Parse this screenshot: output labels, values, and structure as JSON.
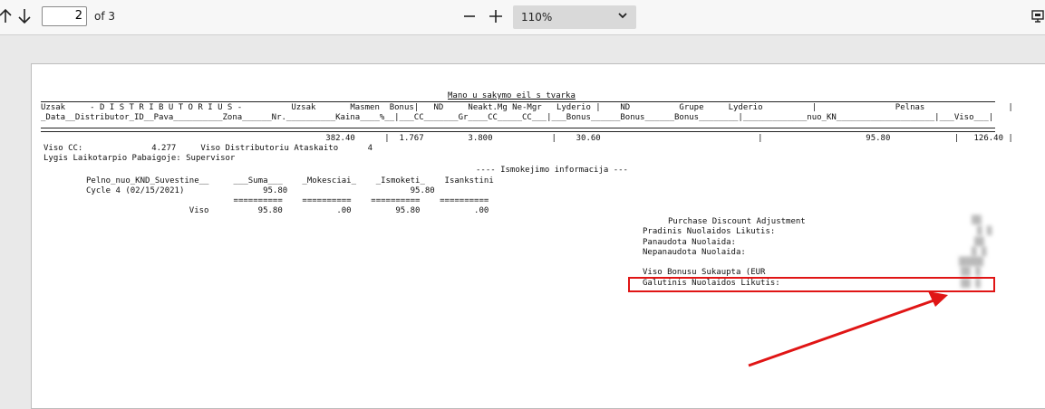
{
  "toolbar": {
    "page_current": "2",
    "page_of": "of 3",
    "zoom_minus": "—",
    "zoom_plus": "+",
    "zoom_value": "110%",
    "zoom_caret": "⌄"
  },
  "report": {
    "title": "Mano_u_sakymo_eil_s_tvarka",
    "header_row1": "Uzsak     - D I S T R I B U T O R I U S -          Uzsak       Masmen  Bonus|   ND     Neakt.Mg Ne-Mgr   Lyderio |    ND          Grupe     Lyderio          |                Pelnas                 |          |",
    "header_row2": "_Data__Distributor_ID__Pava__________Zona______Nr.__________Kaina____%__|___CC_______Gr____CC_____CC___|___Bonus______Bonus______Bonus________|_____________nuo_KN____________________|___Viso___|",
    "totals_row": "                                                          382.40      |  1.767         3.800            |    30.60                                |                     95.80             |   126.40 |",
    "viso_cc": "Viso CC:              4.277     Viso Distributoriu Ataskaito      4",
    "lygis": "Lygis Laikotarpio Pabaigoje: Supervisor",
    "ismokejimo": "---- Ismokejimo informacija ---",
    "pay_header": "Pelno_nuo_KND_Suvestine__     ___Suma___    _Mokesciai_    _Ismoketi_    Isankstini",
    "pay_cycle": "Cycle 4 (02/15/2021)                95.80                         95.80",
    "pay_eq": "                              ==========    ==========    ==========    ==========",
    "pay_total": "                     Viso          95.80           .00         95.80           .00",
    "pda_title": "Purchase Discount Adjustment",
    "pda_lines": [
      "Pradinis Nuolaidos Likutis:",
      "Panaudota Nuolaida:",
      "Nepanaudota Nuolaida:",
      "",
      "Viso Bonusu Sukaupta (EUR",
      "Galutinis Nuolaidos Likutis:"
    ]
  },
  "annotation": {
    "highlight_color": "#e01515"
  }
}
